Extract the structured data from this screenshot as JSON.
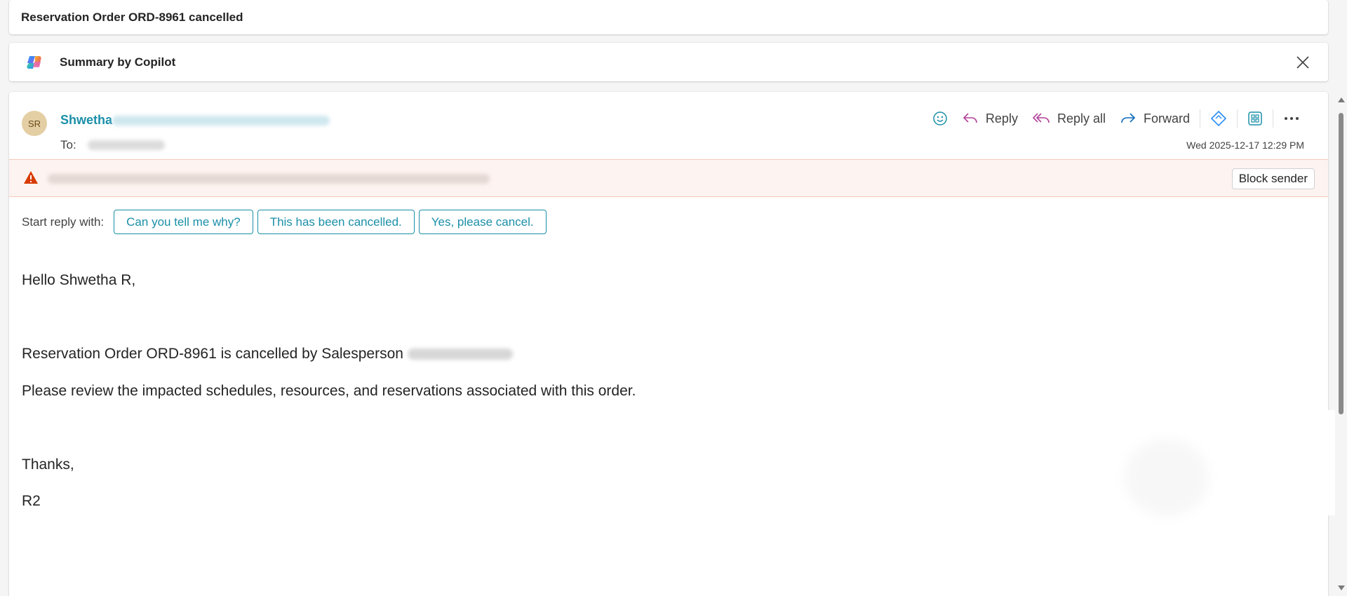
{
  "subject": "Reservation Order ORD-8961 cancelled",
  "copilot": {
    "label": "Summary by Copilot",
    "icon": "copilot-icon",
    "close_icon": "close-icon"
  },
  "message": {
    "avatar_initials": "SR",
    "sender_name": "Shwetha",
    "to_label": "To:",
    "timestamp": "Wed 2025-12-17 12:29 PM",
    "actions": {
      "reply": "Reply",
      "reply_all": "Reply all",
      "forward": "Forward"
    },
    "block_sender": "Block sender",
    "quick_reply_label": "Start reply with:",
    "quick_replies": [
      "Can you tell me why?",
      "This has been cancelled.",
      "Yes, please cancel."
    ],
    "body": {
      "greeting": "Hello Shwetha R,",
      "line1": "Reservation Order ORD-8961 is cancelled by Salesperson",
      "line2": "Please review the impacted schedules, resources, and reservations associated with this order.",
      "thanks": "Thanks,",
      "signature": "R2"
    }
  },
  "colors": {
    "accent": "#1a8fa8",
    "warning_bg": "#fdf3f0",
    "warning_icon": "#d83b01",
    "avatar_bg": "#e3cfa3"
  }
}
